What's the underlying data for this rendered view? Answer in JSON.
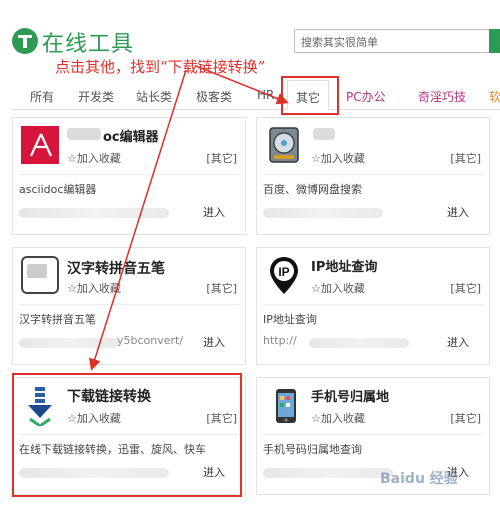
{
  "header": {
    "title": "在线工具",
    "search_placeholder": "搜索其实很简单"
  },
  "instruction": "点击其他，找到“下载链接转换”",
  "tabs": [
    {
      "label": "所有"
    },
    {
      "label": "开发类"
    },
    {
      "label": "站长类"
    },
    {
      "label": "极客类"
    },
    {
      "label": "HR"
    },
    {
      "label": "其它",
      "active": true
    },
    {
      "label": "PC办公"
    },
    {
      "label": "奇淫巧技"
    },
    {
      "label": "软"
    }
  ],
  "card_common": {
    "favorite": "加入收藏",
    "category": "[其它]",
    "enter": "进入"
  },
  "cards": [
    {
      "name": "oc编辑器",
      "desc": "asciidoc编辑器"
    },
    {
      "name": "",
      "desc": "百度、微博网盘搜索"
    },
    {
      "name": "汉字转拼音五笔",
      "desc": "汉字转拼音五笔",
      "url": "y5bconvert/"
    },
    {
      "name": "IP地址查询",
      "desc": "IP地址查询",
      "url": "http://"
    },
    {
      "name": "下载链接转换",
      "desc": "在线下载链接转换，迅雷、旋风、快车"
    },
    {
      "name": "手机号归属地",
      "desc": "手机号码归属地查询"
    }
  ],
  "watermark": "Baidu 经验",
  "colors": {
    "brand": "#2e9b55",
    "annotation": "#e0302a"
  }
}
